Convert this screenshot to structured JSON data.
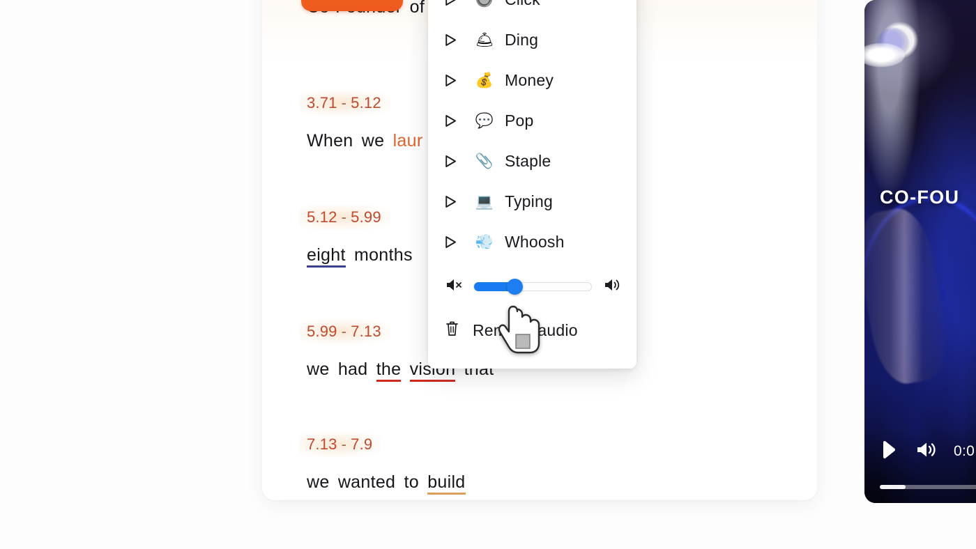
{
  "transcript": {
    "header_text": "Co-Founder of",
    "segments": [
      {
        "start": "3.71",
        "dash": "-",
        "end": "5.12",
        "words": [
          {
            "text": "When",
            "style": "plain"
          },
          {
            "text": "we",
            "style": "plain"
          },
          {
            "text": "laur",
            "style": "orange"
          }
        ]
      },
      {
        "start": "5.12",
        "dash": "-",
        "end": "5.99",
        "words": [
          {
            "text": "eight",
            "style": "underline-blue"
          },
          {
            "text": "months",
            "style": "plain"
          }
        ]
      },
      {
        "start": "5.99",
        "dash": "-",
        "end": "7.13",
        "words": [
          {
            "text": "we",
            "style": "plain"
          },
          {
            "text": "had",
            "style": "plain"
          },
          {
            "text": "the",
            "style": "underline-red"
          },
          {
            "text": "vision",
            "style": "underline-red"
          },
          {
            "text": "that",
            "style": "plain"
          }
        ]
      },
      {
        "start": "7.13",
        "dash": "-",
        "end": "7.9",
        "words": [
          {
            "text": "we",
            "style": "plain"
          },
          {
            "text": "wanted",
            "style": "plain"
          },
          {
            "text": "to",
            "style": "plain"
          },
          {
            "text": "build",
            "style": "underline-orange"
          }
        ]
      }
    ]
  },
  "sfx_menu": {
    "items": [
      {
        "label": "Click",
        "emoji": "🔘",
        "icon_name": "click-sound-icon"
      },
      {
        "label": "Ding",
        "emoji": "🛎",
        "icon_name": "ding-sound-icon"
      },
      {
        "label": "Money",
        "emoji": "💰",
        "icon_name": "money-sound-icon"
      },
      {
        "label": "Pop",
        "emoji": "💬",
        "icon_name": "pop-sound-icon"
      },
      {
        "label": "Staple",
        "emoji": "📎",
        "icon_name": "staple-sound-icon"
      },
      {
        "label": "Typing",
        "emoji": "💻",
        "icon_name": "typing-sound-icon"
      },
      {
        "label": "Whoosh",
        "emoji": "💨",
        "icon_name": "whoosh-sound-icon"
      }
    ],
    "volume": {
      "value_percent": 35,
      "mute_icon": "volume-mute-icon",
      "max_icon": "volume-max-icon"
    },
    "remove_audio_label": "Remove audio"
  },
  "video": {
    "caption_overlay": "CO-FOU",
    "time_label": "0:0",
    "progress_percent": 22,
    "play_icon": "play-icon",
    "volume_icon": "volume-icon"
  },
  "colors": {
    "accent_orange": "#f15a22",
    "timestamp_text": "#c14a2e",
    "slider_blue": "#1d7ef2",
    "underline_red": "#cf2a22",
    "underline_blue": "#3b3f8f",
    "underline_orange": "#dba05a",
    "page_background": "#fdfdfd"
  }
}
